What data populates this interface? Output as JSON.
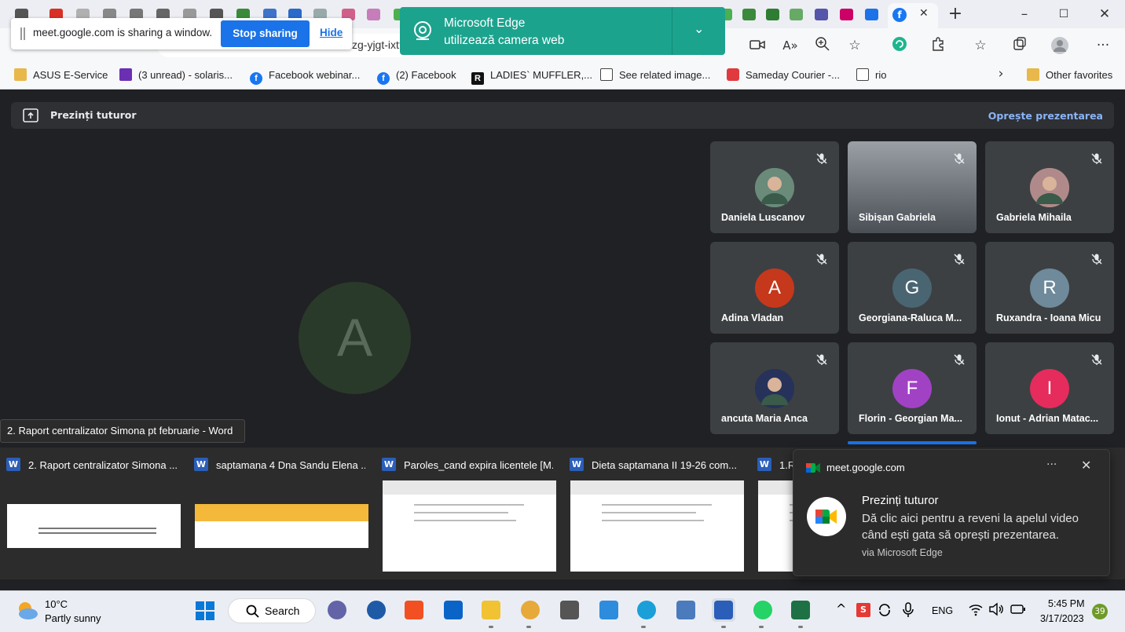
{
  "share_bar": {
    "text": "meet.google.com is sharing a window.",
    "stop_label": "Stop sharing",
    "hide_label": "Hide"
  },
  "address_bar": {
    "url_fragment": "zg-yjgt-ixt?pli="
  },
  "camera_notice": {
    "title": "Microsoft Edge",
    "subtitle": "utilizează camera web"
  },
  "bookmarks": [
    {
      "label": "ASUS E-Service",
      "icon": "folder-icon"
    },
    {
      "label": "(3 unread) - solaris...",
      "icon": "mail-icon"
    },
    {
      "label": "Facebook webinar...",
      "icon": "facebook-icon"
    },
    {
      "label": "(2) Facebook",
      "icon": "facebook-icon"
    },
    {
      "label": "LADIES` MUFFLER,...",
      "icon": "r-logo-icon"
    },
    {
      "label": "See related image...",
      "icon": "page-icon"
    },
    {
      "label": "Sameday Courier -...",
      "icon": "sameday-icon"
    },
    {
      "label": "rio",
      "icon": "page-icon"
    }
  ],
  "other_favorites": "Other favorites",
  "presenting_bar": {
    "title": "Prezinți tuturor",
    "stop_label": "Oprește prezentarea"
  },
  "main_avatar_letter": "A",
  "participants": [
    {
      "name": "Daniela Luscanov",
      "letter": "",
      "color": "#6a8a7a",
      "photo": true
    },
    {
      "name": "Sibișan Gabriela",
      "letter": "",
      "color": "#8a8f96",
      "photo": true
    },
    {
      "name": "Gabriela Mihaila",
      "letter": "",
      "color": "#b08a8a",
      "photo": true
    },
    {
      "name": "Adina Vladan",
      "letter": "A",
      "color": "#c5381b",
      "photo": false
    },
    {
      "name": "Georgiana-Raluca M...",
      "letter": "G",
      "color": "#4a6572",
      "photo": false
    },
    {
      "name": "Ruxandra - Ioana Micu",
      "letter": "R",
      "color": "#6f8a9a",
      "photo": false
    },
    {
      "name": "ancuta Maria Anca",
      "letter": "",
      "color": "#26325a",
      "photo": true
    },
    {
      "name": "Florin - Georgian Ma...",
      "letter": "F",
      "color": "#a142c4",
      "photo": false
    },
    {
      "name": "Ionut - Adrian Matac...",
      "letter": "I",
      "color": "#e52c5c",
      "photo": false
    }
  ],
  "tooltip": "2. Raport centralizator Simona pt februarie - Word",
  "thumbnails": [
    {
      "title": "2. Raport centralizator Simona ..."
    },
    {
      "title": "saptamana 4 Dna Sandu Elena ..."
    },
    {
      "title": "Paroles_cand expira licentele [M..."
    },
    {
      "title": "Dieta saptamana II 19-26 com..."
    },
    {
      "title": "1.R"
    }
  ],
  "notification": {
    "source": "meet.google.com",
    "title": "Prezinți tuturor",
    "body": "Dă clic aici pentru a reveni la apelul video când ești gata să oprești prezentarea.",
    "via": "via Microsoft Edge",
    "more": "···",
    "close": "✕"
  },
  "taskbar": {
    "temperature": "10°C",
    "weather": "Partly sunny",
    "search_label": "Search",
    "language": "ENG",
    "time": "5:45 PM",
    "date": "3/17/2023",
    "badge_count": "39"
  }
}
